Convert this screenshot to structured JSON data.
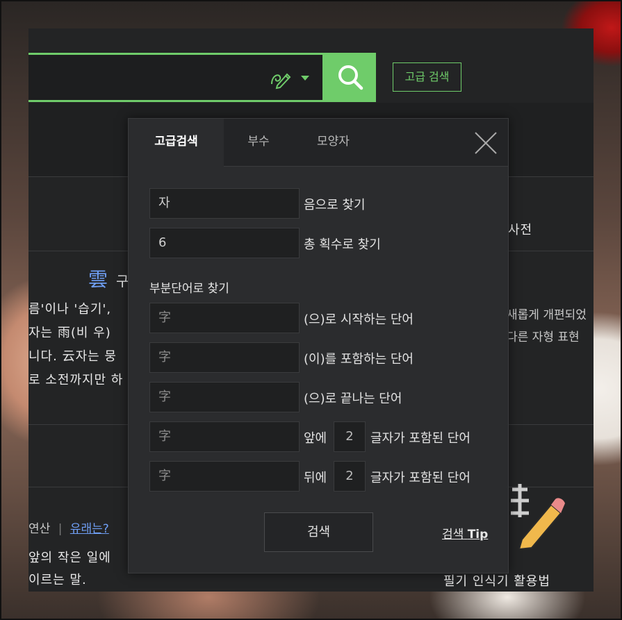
{
  "search": {
    "query": "",
    "advanced_label": "고급 검색"
  },
  "background": {
    "dictionary_tab_fragment": "사전",
    "hanja_char": "雲",
    "hanja_suffix": "구",
    "line_1": "름'이나 '습기',",
    "line_2": "자는 雨(비 우)",
    "line_3": "니다. 云자는 뭉",
    "line_4": "로 소전까지만 하",
    "right_line_1": "새롭게 개편되었",
    "right_line_2": "다른 자형 표현",
    "origin_prefix": "연산",
    "origin_separator": "|",
    "origin_link": "유래는?",
    "idiom_line_1": "앞의 작은 일에",
    "idiom_line_2": "이르는 말.",
    "handwriting_caption": "필기 인식기 활용법"
  },
  "modal": {
    "tabs": [
      {
        "label": "고급검색",
        "active": true
      },
      {
        "label": "부수",
        "active": false
      },
      {
        "label": "모양자",
        "active": false
      }
    ],
    "reading_field": {
      "value": "자",
      "label": "음으로 찾기"
    },
    "stroke_field": {
      "value": "6",
      "label": "총 획수로 찾기"
    },
    "partial_heading": "부분단어로 찾기",
    "starts_with": {
      "placeholder": "字",
      "label": "(으)로 시작하는 단어"
    },
    "contains": {
      "placeholder": "字",
      "label": "(이)를 포함하는 단어"
    },
    "ends_with": {
      "placeholder": "字",
      "label": "(으)로 끝나는 단어"
    },
    "before": {
      "placeholder": "字",
      "prefix": "앞에",
      "count": "2",
      "label": "글자가 포함된 단어"
    },
    "after": {
      "placeholder": "字",
      "prefix": "뒤에",
      "count": "2",
      "label": "글자가 포함된 단어"
    },
    "submit_label": "검색",
    "tip_label": "검색",
    "tip_bold": "Tip"
  },
  "colors": {
    "accent_green": "#6fcc6a",
    "link_blue": "#6f9ff5",
    "panel_dark": "#232425",
    "modal_bg": "#2b2c2e"
  },
  "icons": {
    "handwrite": "handwrite-pen-icon",
    "search": "search-icon",
    "close": "close-icon",
    "caret": "chevron-down-icon"
  }
}
